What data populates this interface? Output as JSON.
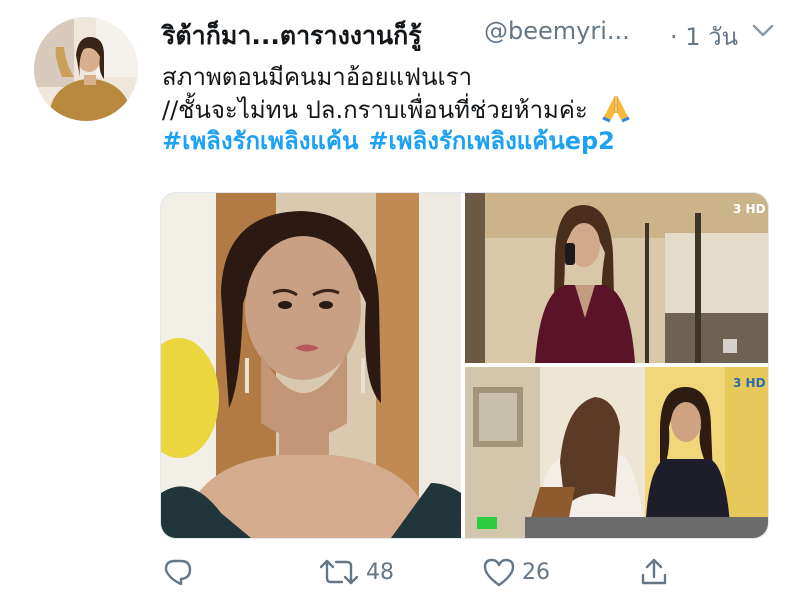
{
  "tweet": {
    "display_name": "ริต้าก็มา...ตารางงานก็รู้",
    "handle": "@beemyri...",
    "timestamp": "· 1 วัน",
    "text_lines": [
      "สภาพตอนมีคนมาอ้อยแฟนเรา",
      "//ชั้นจะไม่ทน ปล.กราบเพื่อนที่ช่วยห้ามค่ะ"
    ],
    "emoji": "folded-hands",
    "hashtags": [
      "#เพลิงรักเพลิงแค้น",
      "#เพลิงรักเพลิงแค้นep2"
    ],
    "media": [
      {
        "name": "woman-worried-face-still",
        "logo": ""
      },
      {
        "name": "woman-on-phone-still",
        "logo": "3 HD"
      },
      {
        "name": "two-women-scene-still",
        "logo": "3 HD"
      }
    ],
    "actions": {
      "reply_icon": "reply-icon",
      "retweet_icon": "retweet-icon",
      "retweet_count": "48",
      "like_icon": "heart-icon",
      "like_count": "26",
      "share_icon": "share-icon"
    }
  },
  "colors": {
    "text": "#14171a",
    "secondary": "#657786",
    "link": "#1da1f2"
  }
}
